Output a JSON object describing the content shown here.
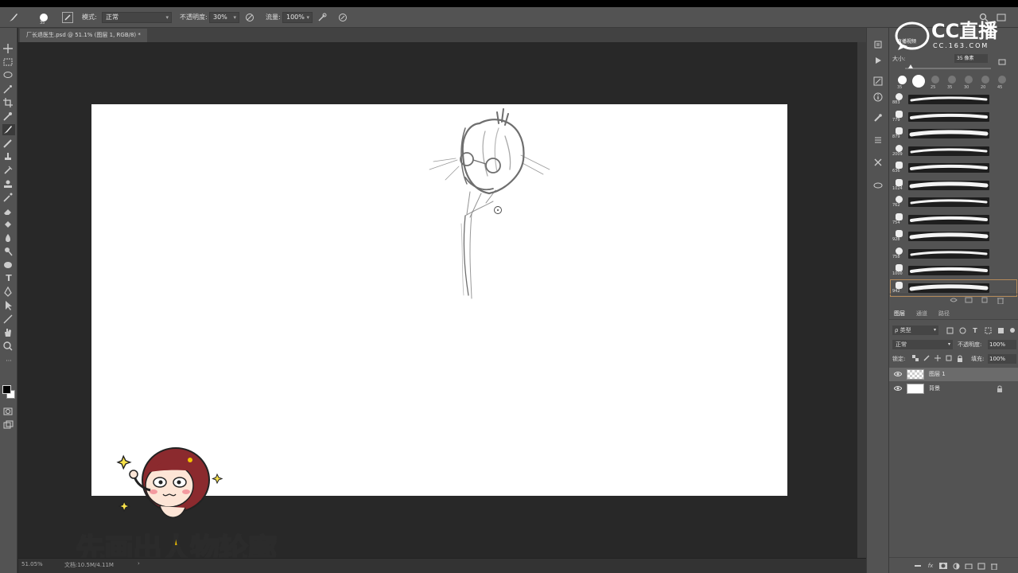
{
  "options_bar": {
    "size_value": "35",
    "mode_label": "模式:",
    "mode_value": "正常",
    "opacity_label": "不透明度:",
    "opacity_value": "30%",
    "flow_label": "流量:",
    "flow_value": "100%"
  },
  "document_tab": {
    "title": "厂长退医生.psd @ 51.1% (图层 1, RGB/8) *"
  },
  "status_bar": {
    "zoom": "51.05%",
    "doc_info": "文档:10.5M/4.11M"
  },
  "watermark": {
    "brand": "CC直播",
    "url": "CC.163.COM",
    "small_label": "直播视频"
  },
  "brush_panel": {
    "size_label": "大小:",
    "size_value": "35 像素",
    "presets_top": [
      "35",
      "",
      "25",
      "35",
      "30",
      "20",
      "45"
    ],
    "preset_numbers": [
      "883",
      "779",
      "879",
      "2009",
      "636",
      "1024",
      "762",
      "754",
      "928",
      "758",
      "1000",
      "942"
    ]
  },
  "layers_panel": {
    "tabs": [
      "图层",
      "通道",
      "路径"
    ],
    "filter_label": "ρ 类型",
    "blend_mode": "正常",
    "opacity_label": "不透明度:",
    "opacity_value": "100%",
    "lock_label": "锁定:",
    "fill_label": "填充:",
    "fill_value": "100%",
    "layers": [
      {
        "name": "图层 1",
        "selected": true
      },
      {
        "name": "背景",
        "selected": false,
        "locked": true
      }
    ]
  },
  "caption": {
    "text": "先画出人物轮廓"
  },
  "colors": {
    "accent": "#f5c400",
    "panel": "#535353",
    "workspace": "#282828"
  }
}
